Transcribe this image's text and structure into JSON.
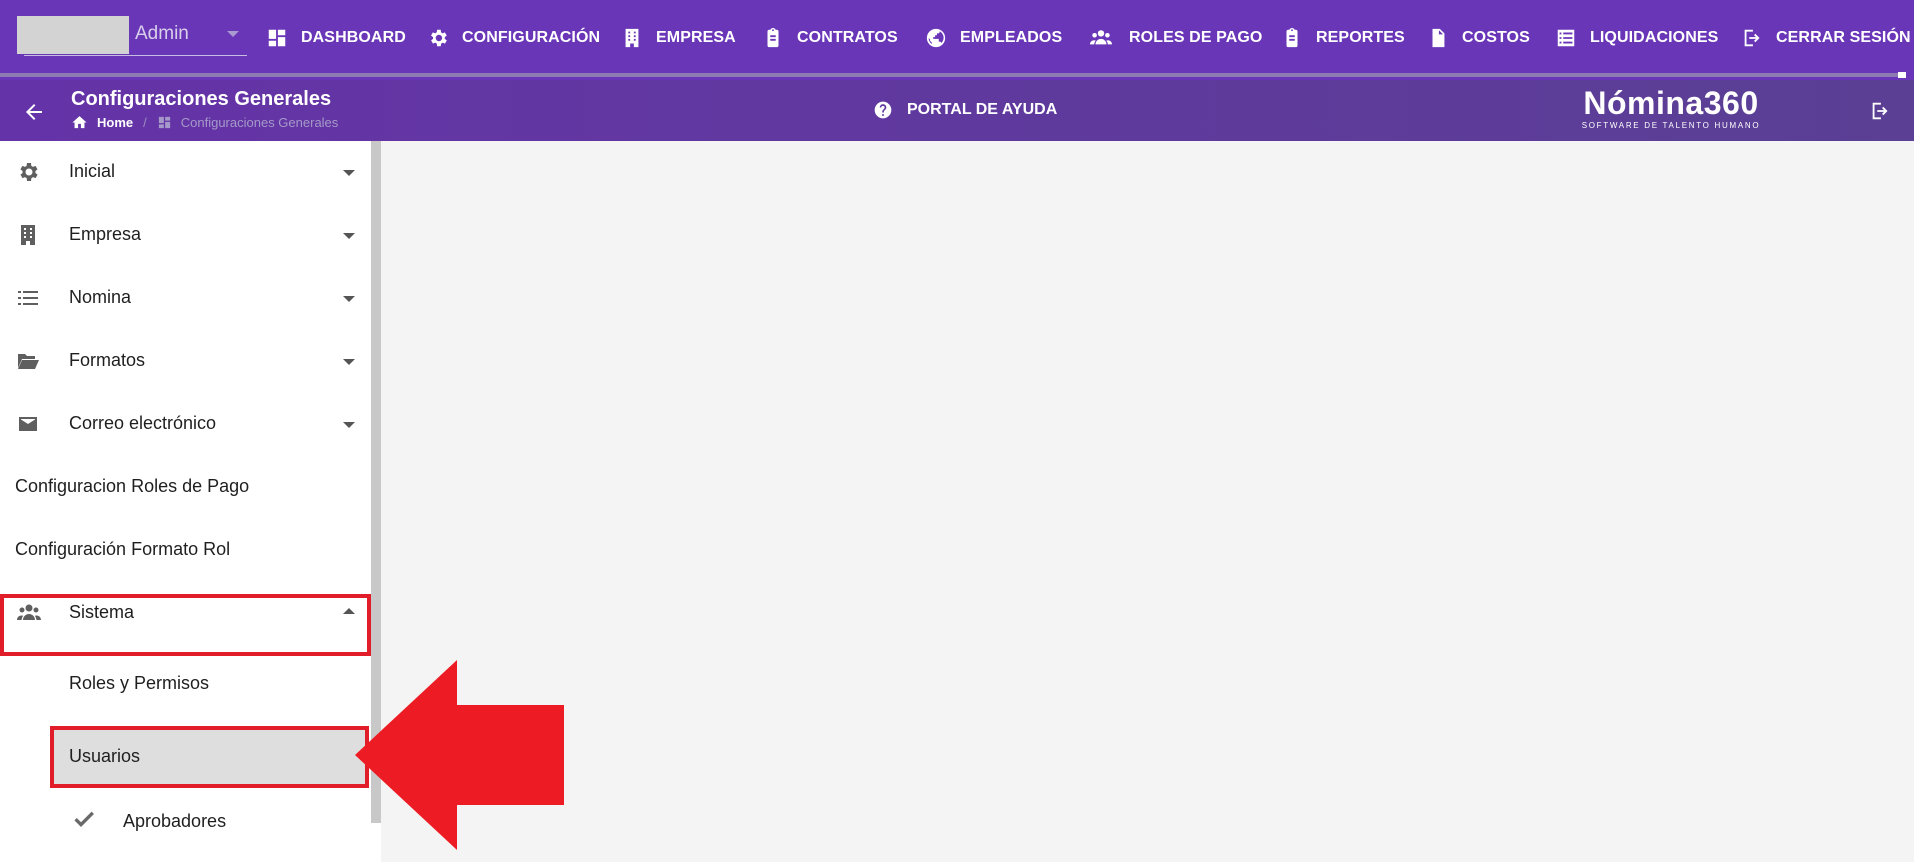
{
  "user": {
    "name": "Admin"
  },
  "topnav": {
    "items": [
      {
        "label": "DASHBOARD",
        "icon": "dashboard-icon"
      },
      {
        "label": "CONFIGURACIÓN",
        "icon": "gear-icon"
      },
      {
        "label": "EMPRESA",
        "icon": "building-icon"
      },
      {
        "label": "CONTRATOS",
        "icon": "clipboard-icon"
      },
      {
        "label": "EMPLEADOS",
        "icon": "globe-icon"
      },
      {
        "label": "ROLES DE PAGO",
        "icon": "users-icon"
      },
      {
        "label": "REPORTES",
        "icon": "clipboard-icon"
      },
      {
        "label": "COSTOS",
        "icon": "invoice-dollar-icon"
      },
      {
        "label": "LIQUIDACIONES",
        "icon": "list-icon"
      },
      {
        "label": "CERRAR SESIÓN",
        "icon": "logout-icon"
      }
    ]
  },
  "header": {
    "title": "Configuraciones Generales",
    "breadcrumb": {
      "home": "Home",
      "current": "Configuraciones Generales"
    },
    "help": "PORTAL DE AYUDA",
    "brand": {
      "name": "Nómina360",
      "tagline": "SOFTWARE DE TALENTO HUMANO"
    }
  },
  "sidebar": {
    "items": [
      {
        "label": "Inicial",
        "icon": "gear-icon",
        "expandable": true
      },
      {
        "label": "Empresa",
        "icon": "building-icon",
        "expandable": true
      },
      {
        "label": "Nomina",
        "icon": "list-icon",
        "expandable": true
      },
      {
        "label": "Formatos",
        "icon": "folder-open-icon",
        "expandable": true
      },
      {
        "label": "Correo electrónico",
        "icon": "mail-icon",
        "expandable": true
      },
      {
        "label": "Configuracion Roles de Pago"
      },
      {
        "label": "Configuración Formato Rol"
      },
      {
        "label": "Sistema",
        "icon": "users-icon",
        "expanded": true,
        "highlighted": true
      }
    ],
    "sistema_children": [
      {
        "label": "Roles y Permisos"
      },
      {
        "label": "Usuarios",
        "selected": true,
        "highlighted": true
      },
      {
        "label": "Aprobadores",
        "icon": "check-icon"
      }
    ]
  },
  "colors": {
    "topnav": "#6a36b8",
    "subbar": "#5f3aa0",
    "highlight": "#e11d2a",
    "main_bg": "#f4f4f4"
  }
}
